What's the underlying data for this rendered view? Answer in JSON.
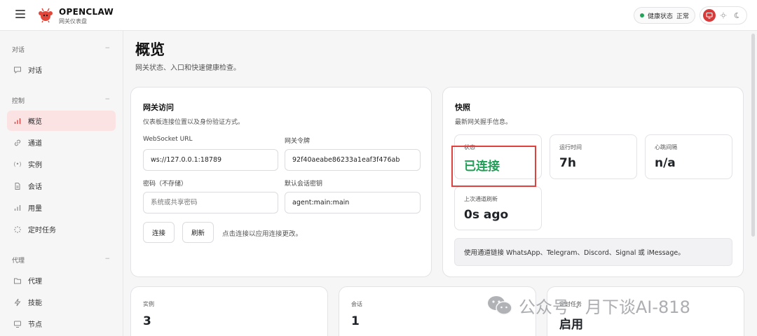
{
  "brand": {
    "name": "OPENCLAW",
    "subtitle": "网关仪表盘"
  },
  "header": {
    "health_label": "健康状态",
    "health_value": "正常"
  },
  "sidebar": {
    "sections": [
      {
        "title": "对话",
        "collapse": "−"
      },
      {
        "title": "控制",
        "collapse": "−"
      },
      {
        "title": "代理",
        "collapse": "−"
      }
    ],
    "items": [
      {
        "label": "对话",
        "icon": "chat-icon"
      },
      {
        "label": "概览",
        "icon": "bar-chart-icon",
        "active": true
      },
      {
        "label": "通道",
        "icon": "link-icon"
      },
      {
        "label": "实例",
        "icon": "broadcast-icon"
      },
      {
        "label": "会话",
        "icon": "document-icon"
      },
      {
        "label": "用量",
        "icon": "bar-chart-icon"
      },
      {
        "label": "定时任务",
        "icon": "loader-icon"
      },
      {
        "label": "代理",
        "icon": "folder-icon"
      },
      {
        "label": "技能",
        "icon": "bolt-icon"
      },
      {
        "label": "节点",
        "icon": "monitor-icon"
      }
    ]
  },
  "page": {
    "title": "概览",
    "subtitle": "网关状态、入口和快速健康检查。"
  },
  "gateway": {
    "title": "网关访问",
    "subtitle": "仪表板连接位置以及身份验证方式。",
    "websocket_label": "WebSocket URL",
    "websocket_value": "ws://127.0.0.1:18789",
    "token_label": "网关令牌",
    "token_value": "92f40aeabe86233a1eaf3f476ab",
    "password_label": "密码（不存储）",
    "password_placeholder": "系统或共享密码",
    "session_label": "默认会话密钥",
    "session_value": "agent:main:main",
    "connect_btn": "连接",
    "refresh_btn": "刷新",
    "hint": "点击连接以应用连接更改。"
  },
  "snapshot": {
    "title": "快照",
    "subtitle": "最新网关握手信息。",
    "status_label": "状态",
    "status_value": "已连接",
    "uptime_label": "运行时间",
    "uptime_value": "7h",
    "heartbeat_label": "心跳间隔",
    "heartbeat_value": "n/a",
    "refresh_label": "上次通道刷新",
    "refresh_value": "0s ago",
    "note": "使用通道链接 WhatsApp、Telegram、Discord、Signal 或 iMessage。"
  },
  "bottom_cards": [
    {
      "label": "实例",
      "value": "3"
    },
    {
      "label": "会话",
      "value": "1"
    },
    {
      "label": "定时任务",
      "value": "启用"
    }
  ],
  "watermark": {
    "text": "公众号 · 月下谈AI-818"
  },
  "colors": {
    "accent": "#d83a3a",
    "ok": "#1e9e55",
    "highlight": "#e0413d"
  }
}
